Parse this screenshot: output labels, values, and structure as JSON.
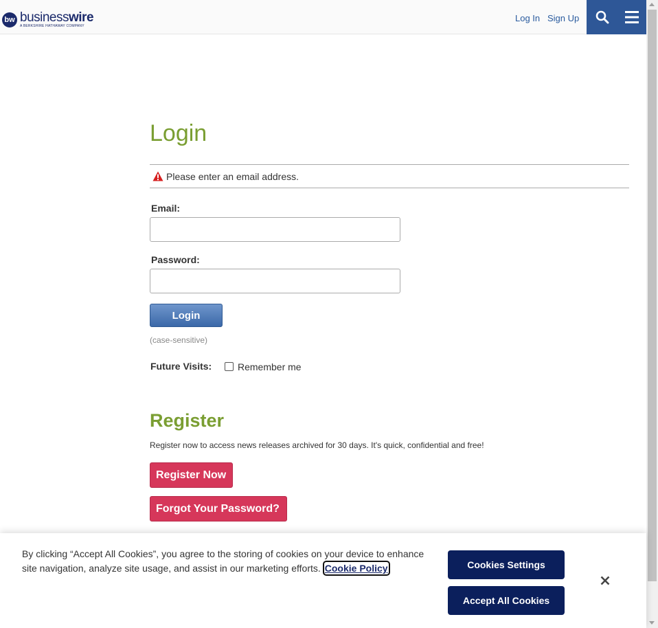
{
  "header": {
    "logo_mark": "bw",
    "logo_word_light": "business",
    "logo_word_bold": "wire",
    "logo_sub": "A BERKSHIRE HATHAWAY COMPANY",
    "login_link": "Log In",
    "signup_link": "Sign Up",
    "search_icon": "search-icon",
    "menu_icon": "hamburger-menu-icon",
    "accent": "#2e5797"
  },
  "main": {
    "title": "Login",
    "alert": "Please enter an email address.",
    "email_label": "Email:",
    "email_value": "",
    "password_label": "Password:",
    "password_value": "",
    "login_button": "Login",
    "hint": "(case-sensitive)",
    "future_visits_label": "Future Visits:",
    "remember_label": "Remember me",
    "remember_checked": false
  },
  "register": {
    "title": "Register",
    "text": "Register now to access news releases archived for 30 days. It's quick, confidential and free!",
    "register_button": "Register Now",
    "forgot_button": "Forgot Your Password?"
  },
  "cookie_banner": {
    "text": "By clicking “Accept All Cookies”, you agree to the storing of cookies on your device to enhance site navigation, analyze site usage, and assist in our marketing efforts.",
    "policy_link": "Cookie Policy",
    "settings_button": "Cookies Settings",
    "accept_button": "Accept All Cookies",
    "close_icon": "close-icon"
  },
  "colors": {
    "title_green": "#7a9e32",
    "red_button": "#d6375a",
    "cookie_navy": "#0b1f5c"
  }
}
